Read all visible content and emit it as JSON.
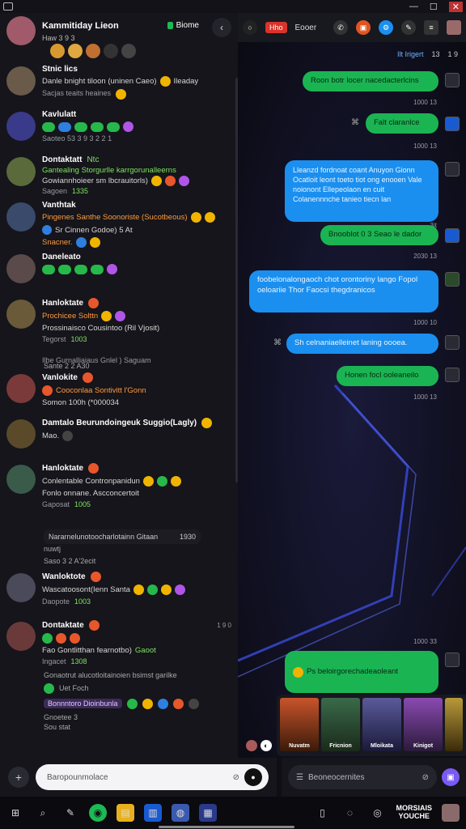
{
  "window": {
    "min_label": "—",
    "max_label": "☐",
    "close_label": "✕"
  },
  "left_header": {
    "title": "Kammitiday Lieon",
    "subtitle": "Haw 3 9 3",
    "tag_label": "Biome",
    "back_icon": "‹"
  },
  "contacts": [
    {
      "name": "Stnic lics",
      "line1": "Danle bnight tiloon (uninen Caeo)",
      "line1_tail": "Ileaday",
      "meta": "Sacjas teaits heaines",
      "avatar_color": "#6a5a4a"
    },
    {
      "name": "Kavlulatt",
      "line1": "",
      "meta": "Saoteo 53 3 9 3 2 2 1",
      "avatar_color": "#3a3a8a"
    },
    {
      "name": "Dontaktatt",
      "name_tail": "Ntc",
      "line1": "Gantealing Storgurlle karrgorunalleerns",
      "line2": "Gowiannhoieer sm lbcrauitorls)",
      "meta": "Sagoen",
      "meta_green": "1335",
      "avatar_color": "#5a6a3a"
    },
    {
      "name": "Vanthtak",
      "line1": "Pingenes Santhe Soonoriste (Sucotbeous)",
      "line2": "Sr Cinnen Godoe) 5 At",
      "line3": "Snacner.",
      "avatar_color": "#3a4a6a"
    },
    {
      "name": "Daneleato",
      "line1": "",
      "avatar_color": "#5a4a4a"
    },
    {
      "name": "Hanloktate",
      "line1": "Prochicee Solttn",
      "line2": "Prossinaisco Cousintoo (Ril Vjosit)",
      "meta": "Tegorst",
      "meta_green": "1003",
      "avatar_color": "#6a5a3a"
    },
    {
      "name": "Vanlokite",
      "line1": "Cooconlaa Sontivitt l'Gonn",
      "line2": "Somon 100h (*000034",
      "avatar_color": "#7a3a3a"
    },
    {
      "name": "Damtalo Beurundoingeuk Suggio(Lagly)",
      "line2": "Mao.",
      "avatar_color": "#5a4a2a"
    },
    {
      "name": "Hanloktate",
      "line1": "Conlentable Contronpanidun",
      "line2": "Fonlo onnane. Ascconcertoit",
      "meta": "Gaposat",
      "meta_green": "1005",
      "avatar_color": "#3a5a4a"
    },
    {
      "name": "Wanloktote",
      "line1": "Wascatoosont(Ienn Santa",
      "meta": "Daopote",
      "meta_green": "1003",
      "avatar_color": "#4a4a5a"
    },
    {
      "name": "Dontaktate",
      "line1": "",
      "line2": "Fao Gontlitthan fearnotbo)",
      "line2_tail": "Gaoot",
      "meta": "Ingacet",
      "meta_green": "1308",
      "avatar_color": "#6a3a3a"
    }
  ],
  "left_extras": {
    "status_line": "Ilbe Gurnalliaiaus Gnlel ) Saguam",
    "status_time": "Sante 2 2 A30",
    "card_text": "Nararnelunotoocharlotainn Gitaan",
    "card_time": "1930",
    "card_sub": "nuwtj",
    "card_meta": "Saso 3 2 A'2ecit",
    "ts_1": "1 9 0",
    "foot_line": "Gonaotrut alucotloitainoien bsimst garilke",
    "foot_line2": "Uet Foch",
    "foot_tag": "Bonnntoro Dioinbunla",
    "foot_meta": "Gnoetee 3",
    "foot_meta2": "Sou stat"
  },
  "right_header": {
    "label_red": "Hho",
    "title": "Eooer",
    "sub_link": "Ilt Irigert",
    "sub_a": "13",
    "sub_b": "1 9"
  },
  "messages": [
    {
      "text": "Roon botr locer nacedacterlcins",
      "type": "g",
      "time": "1000 13"
    },
    {
      "text": "Falt claranlce",
      "type": "g",
      "time": "1000 13"
    },
    {
      "text": "Lleanzd fordnoat coant Anuyon Gionn Ocatloit leont toeto tiot ong enooen Vale noionont Ellepeolaon en cuit Colanennnche tanieo tiecn lan",
      "type": "b",
      "time": "3it"
    },
    {
      "text": "Bnooblot 0 3 Seao le dador",
      "type": "g",
      "time": "2030 13"
    },
    {
      "text": "foobelonalongaoch chot orontoriny lango Fopol oeloariie Thor Faocsi thegdranicos",
      "type": "b",
      "time": "1000 10"
    },
    {
      "text": "Sh celnaniaelleinet laning oooea.",
      "type": "b",
      "time": ""
    },
    {
      "text": "Honen focl ooleaneilo",
      "type": "g",
      "time": "1000 13"
    },
    {
      "text": "Ps beloirgorechadeaoleant",
      "type": "g",
      "time": "1000 33"
    }
  ],
  "thumbnails": [
    {
      "label": "Nuvatm",
      "color": "#7a2a1a"
    },
    {
      "label": "Fricnion",
      "color": "#2a5a3a"
    },
    {
      "label": "Mloikata",
      "color": "#3a3a6a"
    },
    {
      "label": "Kinigot",
      "color": "#5a2a6a"
    },
    {
      "label": "",
      "color": "#7a6a2a"
    }
  ],
  "compose_left": {
    "placeholder": "Baropounmolace"
  },
  "compose_right": {
    "placeholder": "Beoneocernites"
  },
  "taskbar": {
    "tray_line1": "MORSIAIS",
    "tray_line2": "YOUCHE"
  }
}
